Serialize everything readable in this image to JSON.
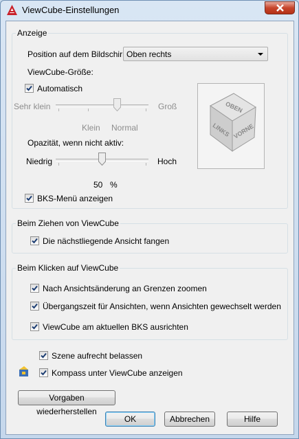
{
  "window": {
    "title": "ViewCube-Einstellungen"
  },
  "display": {
    "group_title": "Anzeige",
    "position_label": "Position auf dem Bildschirm:",
    "position_value": "Oben rechts",
    "size_label": "ViewCube-Größe:",
    "auto_label": "Automatisch",
    "auto_checked": true,
    "size_min": "Sehr klein",
    "size_max": "Groß",
    "size_klein": "Klein",
    "size_normal": "Normal",
    "size_level": "Normal",
    "opacity_label": "Opazität, wenn nicht aktiv:",
    "opacity_min": "Niedrig",
    "opacity_max": "Hoch",
    "opacity_value": "50",
    "opacity_unit": "%",
    "ucs_menu_label": "BKS-Menü anzeigen",
    "ucs_menu_checked": true
  },
  "cube": {
    "top_face": "OBEN",
    "left_face": "LINKS",
    "right_face": "VORNE"
  },
  "drag": {
    "group_title": "Beim Ziehen von ViewCube",
    "snap_label": "Die nächstliegende Ansicht fangen",
    "snap_checked": true
  },
  "click": {
    "group_title": "Beim Klicken auf ViewCube",
    "zoom_label": "Nach Ansichtsänderung an Grenzen zoomen",
    "zoom_checked": true,
    "transition_label": "Übergangszeit für Ansichten, wenn Ansichten gewechselt werden",
    "transition_checked": true,
    "align_label": "ViewCube am aktuellen BKS ausrichten",
    "align_checked": true
  },
  "extra": {
    "upright_label": "Szene aufrecht belassen",
    "upright_checked": true,
    "compass_label": "Kompass unter ViewCube anzeigen",
    "compass_checked": true
  },
  "buttons": {
    "restore": "Vorgaben wiederherstellen",
    "ok": "OK",
    "cancel": "Abbrechen",
    "help": "Hilfe"
  }
}
